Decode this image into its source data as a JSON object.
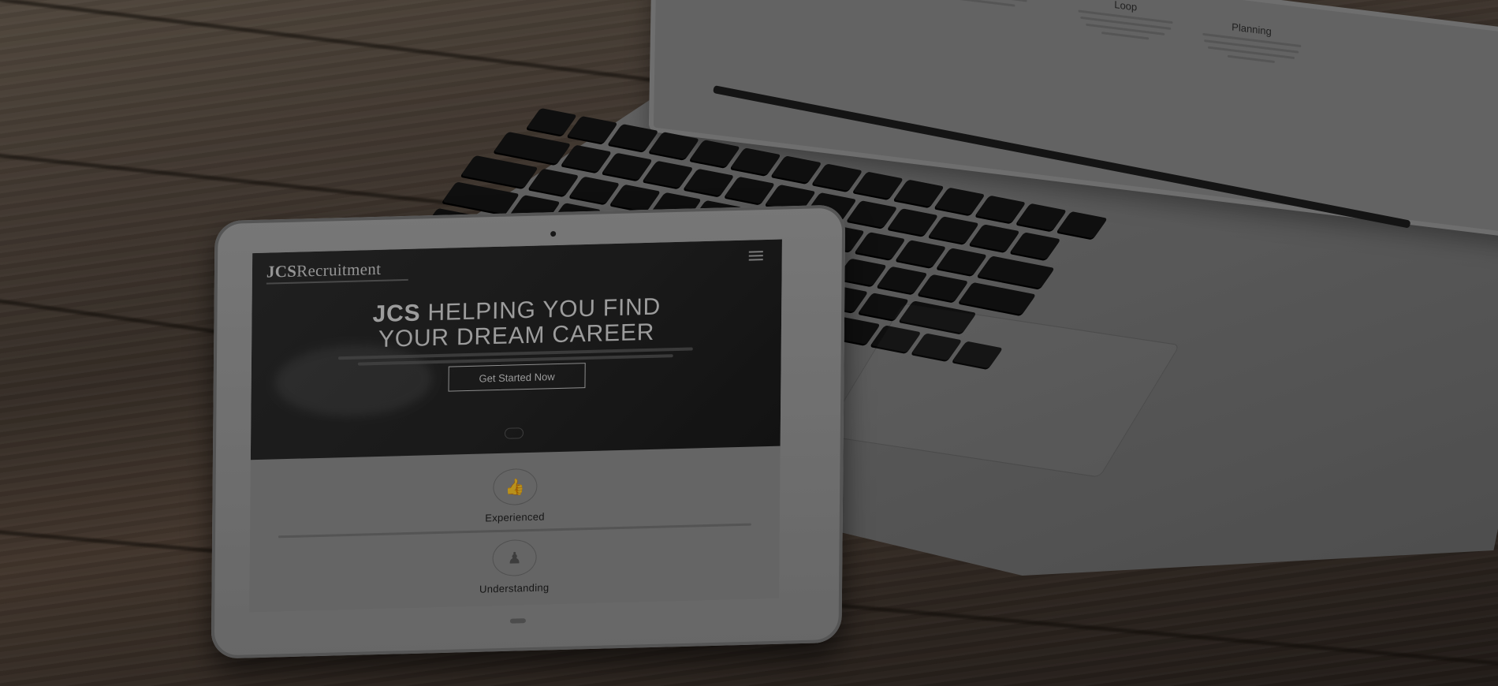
{
  "laptop": {
    "columns": [
      {
        "title": "",
        "visible": false
      },
      {
        "title": "Loop",
        "visible": true
      },
      {
        "title": "Planning",
        "visible": true
      }
    ]
  },
  "tablet": {
    "brand": {
      "strong": "JCS",
      "rest": "Recruitment"
    },
    "hero": {
      "title_strong": "JCS",
      "title_rest": "HELPING YOU FIND",
      "title_line2": "YOUR DREAM CAREER",
      "cta_label": "Get Started Now"
    },
    "features": [
      {
        "title": "Experienced",
        "icon": "thumbs-up-icon"
      },
      {
        "title": "Understanding",
        "icon": "user-plus-icon"
      }
    ]
  }
}
